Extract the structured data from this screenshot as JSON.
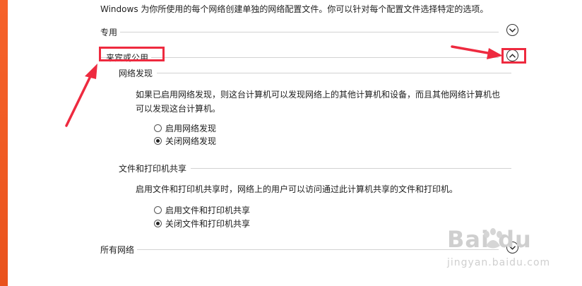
{
  "intro_text": "Windows 为你所使用的每个网络创建单独的网络配置文件。你可以针对每个配置文件选择特定的选项。",
  "sections": {
    "private": {
      "title": "专用",
      "toggle_icon": "chevron-down-icon"
    },
    "guest_public": {
      "title": "来宾或公用",
      "toggle_icon": "chevron-up-icon"
    },
    "all_networks": {
      "title": "所有网络",
      "toggle_icon": "chevron-down-icon"
    }
  },
  "network_discovery": {
    "title": "网络发现",
    "description_line1": "如果已启用网络发现，则这台计算机可以发现网络上的其他计算机和设备，而且其他网络计算机也",
    "description_line2": "可以发现这台计算机。",
    "options": [
      {
        "label": "启用网络发现",
        "checked": false
      },
      {
        "label": "关闭网络发现",
        "checked": true
      }
    ]
  },
  "file_printer_sharing": {
    "title": "文件和打印机共享",
    "description": "启用文件和打印机共享时，网络上的用户可以访问通过此计算机共享的文件和打印机。",
    "options": [
      {
        "label": "启用文件和打印机共享",
        "checked": false
      },
      {
        "label": "关闭文件和打印机共享",
        "checked": true
      }
    ]
  },
  "annotation_color": "#ee2a3f",
  "accent_color": "#ef5a22",
  "watermark": {
    "logo": "Bai  du",
    "url": "jingyan.baidu.com"
  }
}
